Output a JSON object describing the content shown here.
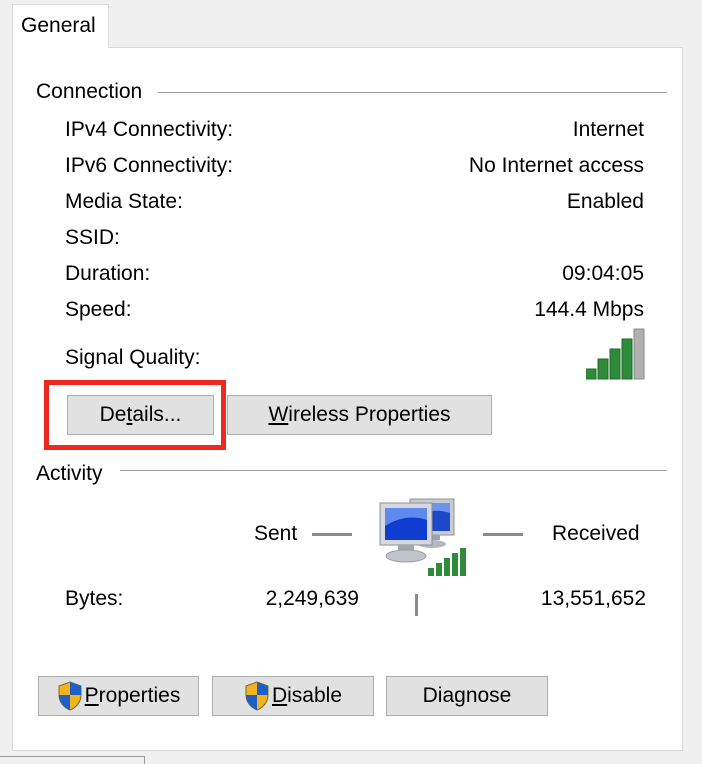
{
  "tab": {
    "label": "General"
  },
  "connection": {
    "heading": "Connection",
    "rows": [
      {
        "label": "IPv4 Connectivity:",
        "value": "Internet"
      },
      {
        "label": "IPv6 Connectivity:",
        "value": "No Internet access"
      },
      {
        "label": "Media State:",
        "value": "Enabled"
      },
      {
        "label": "SSID:",
        "value": ""
      },
      {
        "label": "Duration:",
        "value": "09:04:05"
      },
      {
        "label": "Speed:",
        "value": "144.4 Mbps"
      }
    ],
    "signal_label": "Signal Quality:",
    "signal_bars_filled": 4,
    "signal_bars_total": 5,
    "signal_icon": "signal-strength-icon",
    "details_button": {
      "pre": "De",
      "mnemonic": "t",
      "post": "ails..."
    },
    "wireless_button": {
      "mnemonic": "W",
      "post": "ireless Properties"
    }
  },
  "activity": {
    "heading": "Activity",
    "sent_label": "Sent",
    "received_label": "Received",
    "bytes_label": "Bytes:",
    "bytes_sent": "2,249,639",
    "bytes_received": "13,551,652",
    "network_icon": "network-computers-icon"
  },
  "buttons": {
    "properties": {
      "mnemonic": "P",
      "post": "roperties"
    },
    "disable": {
      "mnemonic": "D",
      "post": "isable"
    },
    "diagnose": {
      "label": "Diagnose"
    }
  },
  "colors": {
    "highlight": "#f0281e",
    "signal_green": "#2e8b3a",
    "button_face": "#e1e1e1"
  }
}
